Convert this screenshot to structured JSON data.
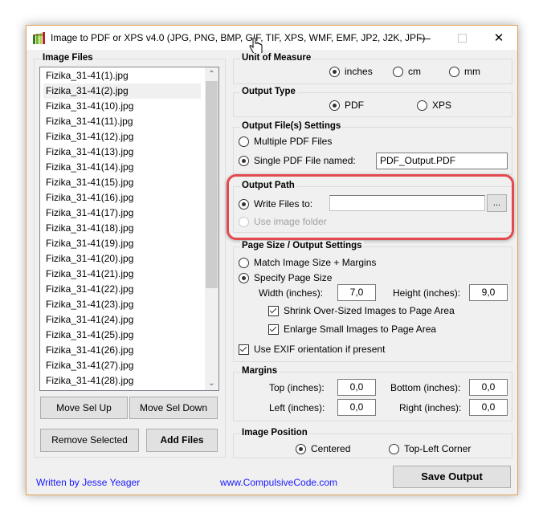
{
  "window": {
    "title": "Image to PDF or XPS  v4.0   (JPG, PNG, BMP, GIF, TIF, XPS, WMF, EMF, JP2, J2K, JPF)",
    "minimize_icon": "minimize-icon",
    "maximize_icon": "maximize-icon",
    "close_icon": "close-icon",
    "accent_color": "#e5a552"
  },
  "image_files": {
    "label": "Image Files",
    "items": [
      "Fizika_31-41(1).jpg",
      "Fizika_31-41(2).jpg",
      "Fizika_31-41(10).jpg",
      "Fizika_31-41(11).jpg",
      "Fizika_31-41(12).jpg",
      "Fizika_31-41(13).jpg",
      "Fizika_31-41(14).jpg",
      "Fizika_31-41(15).jpg",
      "Fizika_31-41(16).jpg",
      "Fizika_31-41(17).jpg",
      "Fizika_31-41(18).jpg",
      "Fizika_31-41(19).jpg",
      "Fizika_31-41(20).jpg",
      "Fizika_31-41(21).jpg",
      "Fizika_31-41(22).jpg",
      "Fizika_31-41(23).jpg",
      "Fizika_31-41(24).jpg",
      "Fizika_31-41(25).jpg",
      "Fizika_31-41(26).jpg",
      "Fizika_31-41(27).jpg",
      "Fizika_31-41(28).jpg"
    ],
    "selected_index": 1,
    "buttons": {
      "move_up": "Move Sel Up",
      "move_down": "Move Sel Down",
      "remove": "Remove Selected",
      "add": "Add Files"
    }
  },
  "unit_of_measure": {
    "label": "Unit of Measure",
    "options": [
      "inches",
      "cm",
      "mm"
    ],
    "selected": "inches"
  },
  "output_type": {
    "label": "Output Type",
    "options": [
      "PDF",
      "XPS"
    ],
    "selected": "PDF"
  },
  "output_files": {
    "label": "Output File(s) Settings",
    "multiple": "Multiple PDF Files",
    "single": "Single PDF File named:",
    "selected": "single",
    "filename": "PDF_Output.PDF"
  },
  "output_path": {
    "label": "Output Path",
    "write_files": "Write Files to:",
    "use_image_folder": "Use image folder",
    "path_value": "",
    "browse_label": "...",
    "highlight_color": "#e34a4f"
  },
  "page_size": {
    "label": "Page Size / Output Settings",
    "match": "Match Image Size + Margins",
    "specify": "Specify Page Size",
    "selected": "specify",
    "width_label": "Width (inches):",
    "width_value": "7,0",
    "height_label": "Height (inches):",
    "height_value": "9,0",
    "shrink": "Shrink Over-Sized Images to Page Area",
    "enlarge": "Enlarge Small Images to Page Area",
    "exif": "Use EXIF orientation if present",
    "shrink_checked": true,
    "enlarge_checked": true,
    "exif_checked": true
  },
  "margins": {
    "label": "Margins",
    "top_label": "Top (inches):",
    "top_value": "0,0",
    "bottom_label": "Bottom (inches):",
    "bottom_value": "0,0",
    "left_label": "Left (inches):",
    "left_value": "0,0",
    "right_label": "Right (inches):",
    "right_value": "0,0"
  },
  "image_position": {
    "label": "Image Position",
    "options": [
      "Centered",
      "Top-Left Corner"
    ],
    "selected": "Centered"
  },
  "footer": {
    "author": "Written by Jesse Yeager",
    "website": "www.CompulsiveCode.com",
    "save": "Save Output",
    "link_color": "#1a1aff"
  }
}
